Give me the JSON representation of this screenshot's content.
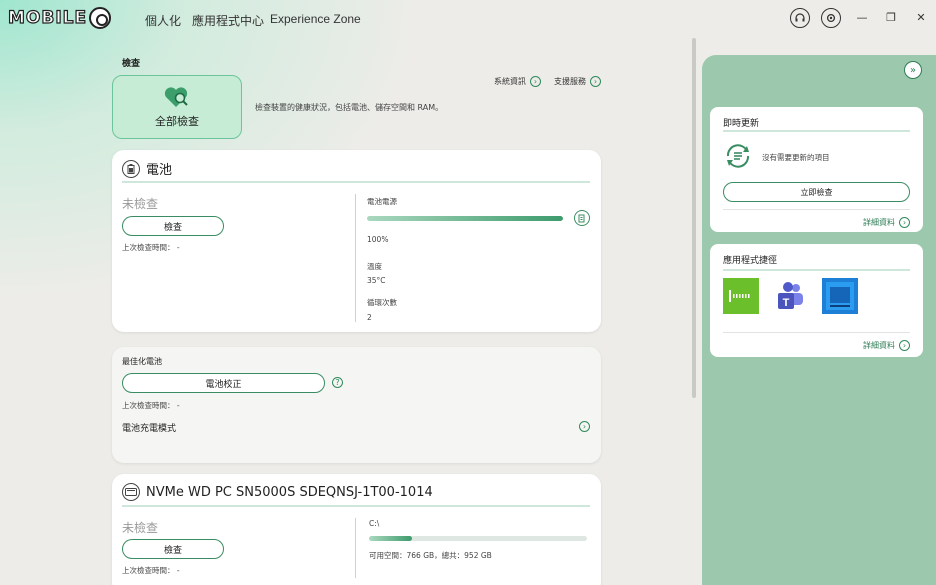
{
  "topbar": {
    "logo": "MOBILE",
    "nav": [
      "個人化",
      "應用程式中心",
      "Experience Zone"
    ],
    "icons": [
      "headset-icon",
      "gear-icon"
    ],
    "window_buttons": [
      "—",
      "❐",
      "✕"
    ]
  },
  "check_section": {
    "title": "檢查",
    "system_info": "系統資訊",
    "support": "支援服務",
    "full_check_label": "全部檢查",
    "description": "檢查裝置的健康狀況，包括電池、儲存空間和 RAM。"
  },
  "battery": {
    "title": "電池",
    "status": "未檢查",
    "check_button": "檢查",
    "last_check": "上次檢查時間： -",
    "power_label": "電池電源",
    "power_value": "100%",
    "power_fraction": 1.0,
    "temp_label": "溫度",
    "temp_value": "35°C",
    "cycles_label": "循環次數",
    "cycles_value": "2"
  },
  "optimize": {
    "title": "最佳化電池",
    "calibrate_button": "電池校正",
    "last_check": "上次檢查時間： -",
    "charge_mode": "電池充電模式"
  },
  "storage": {
    "title": "NVMe WD PC SN5000S SDEQNSJ-1T00-1014",
    "status": "未檢查",
    "check_button": "檢查",
    "last_check": "上次檢查時間： -",
    "drive": "C:\\",
    "usage_fraction": 0.196,
    "space_text": "可用空間：766 GB，總共：952 GB"
  },
  "updates": {
    "title": "即時更新",
    "message": "沒有需要更新的項目",
    "check_now": "立即檢查",
    "details": "詳細資料"
  },
  "shortcuts": {
    "title": "應用程式捷徑",
    "details": "詳細資料",
    "apps": [
      "audio-app-icon",
      "teams-icon",
      "store-app-icon"
    ]
  },
  "colors": {
    "accent": "#3a8d62",
    "panel": "#9cc9ad",
    "background": "#edece8"
  }
}
